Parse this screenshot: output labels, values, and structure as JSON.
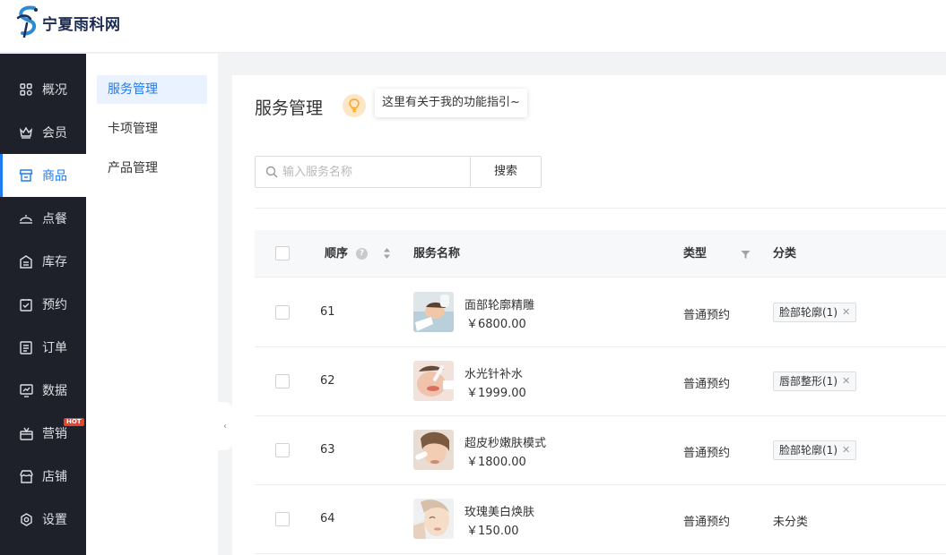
{
  "app": {
    "brand": "宁夏雨科网"
  },
  "sidebar": {
    "items": [
      {
        "label": "概况",
        "icon": "dashboard-icon"
      },
      {
        "label": "会员",
        "icon": "crown-icon"
      },
      {
        "label": "商品",
        "icon": "store-icon",
        "active": true
      },
      {
        "label": "点餐",
        "icon": "dish-bell-icon"
      },
      {
        "label": "库存",
        "icon": "inventory-icon"
      },
      {
        "label": "预约",
        "icon": "calendar-check-icon"
      },
      {
        "label": "订单",
        "icon": "order-list-icon"
      },
      {
        "label": "数据",
        "icon": "chart-monitor-icon"
      },
      {
        "label": "营销",
        "icon": "gift-icon",
        "badge": "HOT"
      },
      {
        "label": "店铺",
        "icon": "shop-icon"
      },
      {
        "label": "设置",
        "icon": "settings-icon"
      }
    ]
  },
  "subnav": {
    "items": [
      {
        "label": "服务管理",
        "active": true
      },
      {
        "label": "卡项管理"
      },
      {
        "label": "产品管理"
      }
    ]
  },
  "main": {
    "title": "服务管理",
    "tip": "这里有关于我的功能指引~",
    "search": {
      "placeholder": "输入服务名称",
      "button": "搜索"
    },
    "table": {
      "headers": {
        "order": "顺序",
        "name": "服务名称",
        "type": "类型",
        "category": "分类"
      },
      "rows": [
        {
          "order": "61",
          "name": "面部轮廓精雕",
          "price": "￥6800.00",
          "type": "普通预约",
          "category": "脸部轮廓(1)",
          "thumb": "face-sculpting-photo"
        },
        {
          "order": "62",
          "name": "水光针补水",
          "price": "￥1999.00",
          "type": "普通预约",
          "category": "唇部整形(1)",
          "thumb": "hydration-injection-photo"
        },
        {
          "order": "63",
          "name": "超皮秒嫩肤模式",
          "price": "￥1800.00",
          "type": "普通预约",
          "category": "脸部轮廓(1)",
          "thumb": "laser-rejuvenation-photo"
        },
        {
          "order": "64",
          "name": "玫瑰美白焕肤",
          "price": "￥150.00",
          "type": "普通预约",
          "category": "未分类",
          "thumb": "rose-whitening-photo"
        }
      ]
    }
  },
  "colors": {
    "accent": "#1f7bf0",
    "sidebar_bg": "#1e2129",
    "hot_badge": "#e8442b"
  }
}
